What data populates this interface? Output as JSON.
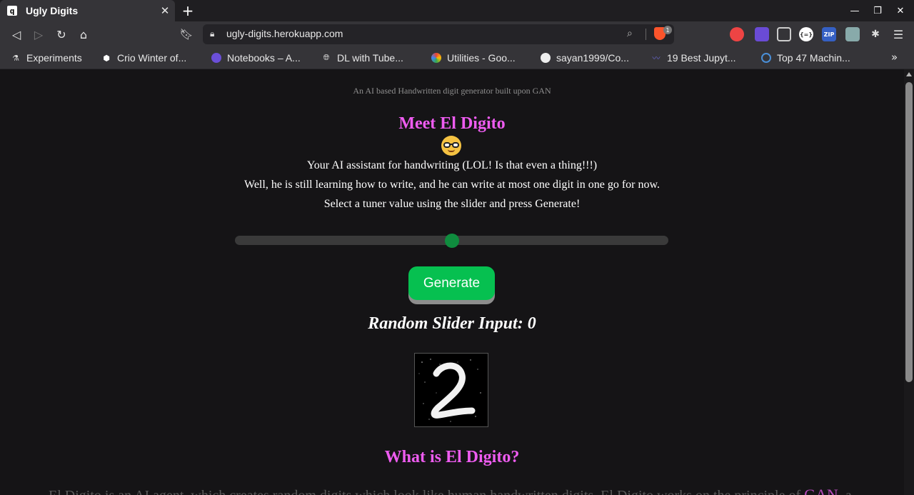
{
  "browser": {
    "tab": {
      "title": "Ugly Digits",
      "favicon_icon": "q-logo-icon"
    },
    "url": "ugly-digits.herokuapp.com",
    "bookmarks": [
      {
        "label": "Experiments",
        "icon": "flask-icon"
      },
      {
        "label": "Crio Winter of...",
        "icon": "crio-icon"
      },
      {
        "label": "Notebooks – A...",
        "icon": "brain-icon"
      },
      {
        "label": "DL with Tube...",
        "icon": "globe-icon"
      },
      {
        "label": "Utilities - Goo...",
        "icon": "pinwheel-icon"
      },
      {
        "label": "sayan1999/Co...",
        "icon": "github-icon"
      },
      {
        "label": "19 Best Jupyt...",
        "icon": "wave-icon"
      },
      {
        "label": "Top 47 Machin...",
        "icon": "circle-logo-icon"
      }
    ],
    "brave_badge": "1"
  },
  "page": {
    "subtitle": "An AI based Handwritten digit generator built upon GAN",
    "heading": "Meet El Digito",
    "emoji": "nerd-face-icon",
    "intro_lines": [
      "Your AI assistant for handwriting (LOL! Is that even a thing!!!)",
      "Well, he is still learning how to write, and he can write at most one digit in one go for now.",
      "Select a tuner value using the slider and press Generate!"
    ],
    "slider": {
      "value": 0.5
    },
    "generate_label": "Generate",
    "random_label": "Random Slider Input: 0",
    "section_heading": "What is El Digito?",
    "paragraph_start": "El Digito is an AI agent, which creates random digits which look like human handwritten digits. El Digito works on the principle of ",
    "paragraph_link": "GAN",
    "paragraph_end": ", a"
  },
  "colors": {
    "accent_pink": "#ee5cf0",
    "button_green": "#06c050",
    "slider_thumb": "#0f8c3e"
  }
}
